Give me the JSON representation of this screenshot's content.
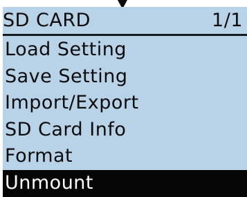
{
  "header": {
    "title": "SD CARD",
    "page": "1/1"
  },
  "menu": {
    "items": [
      {
        "label": "Load Setting"
      },
      {
        "label": "Save Setting"
      },
      {
        "label": "Import/Export"
      },
      {
        "label": "SD Card Info"
      },
      {
        "label": "Format"
      },
      {
        "label": "Unmount",
        "selected": true
      }
    ]
  },
  "colors": {
    "panel_background": "#b8d2e8",
    "selected_background": "#050505",
    "selected_text": "#ffffff",
    "text": "#0b0b0b"
  },
  "icons": {
    "scroll_up_indicator": "triangle-down-icon"
  }
}
